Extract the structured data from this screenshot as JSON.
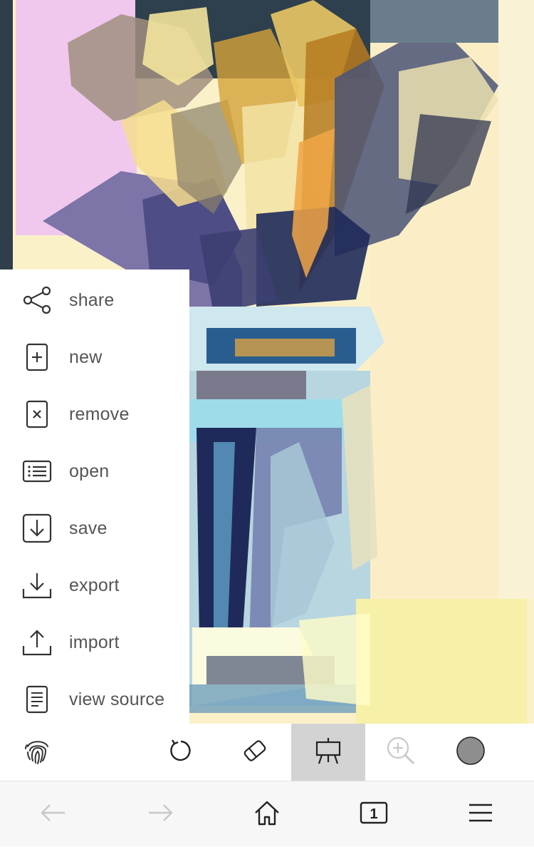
{
  "menu": {
    "items": [
      {
        "label": "share",
        "icon": "share-icon"
      },
      {
        "label": "new",
        "icon": "new-file-icon"
      },
      {
        "label": "remove",
        "icon": "remove-file-icon"
      },
      {
        "label": "open",
        "icon": "list-icon"
      },
      {
        "label": "save",
        "icon": "save-icon"
      },
      {
        "label": "export",
        "icon": "download-icon"
      },
      {
        "label": "import",
        "icon": "upload-icon"
      },
      {
        "label": "view source",
        "icon": "document-icon"
      }
    ]
  },
  "toolbar": {
    "tools": [
      {
        "name": "fingerprint",
        "icon": "fingerprint-icon"
      },
      {
        "name": "undo",
        "icon": "undo-icon"
      },
      {
        "name": "eraser",
        "icon": "eraser-icon"
      },
      {
        "name": "easel",
        "icon": "easel-icon",
        "active": true
      },
      {
        "name": "zoom",
        "icon": "zoom-in-icon",
        "disabled": true
      },
      {
        "name": "color",
        "icon": "color-swatch-icon"
      }
    ],
    "current_color": "#8e8e8e"
  },
  "browser_nav": {
    "tab_count": "1",
    "back_enabled": false,
    "forward_enabled": false
  },
  "colors": {
    "active_tool_bg": "#d3d3d3",
    "icon_gray": "#333333",
    "disabled_icon": "#c8c8c8",
    "painting_navy": "#1f2a5a",
    "painting_yellow": "#fbf1c9",
    "painting_pink": "#f0c8ee"
  }
}
